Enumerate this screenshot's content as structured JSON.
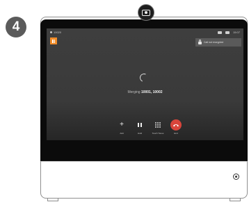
{
  "step": {
    "number": "4"
  },
  "status_bar": {
    "left_text": "10020",
    "right_text": "15:07"
  },
  "encryption": {
    "text": "Call not encrypted"
  },
  "call": {
    "merging_prefix": "Merging",
    "participants": "10001, 10002"
  },
  "controls": [
    {
      "label": "Add",
      "icon": "plus-icon"
    },
    {
      "label": "Hold",
      "icon": "pause-icon"
    },
    {
      "label": "Touch Tones",
      "icon": "keypad-icon"
    },
    {
      "label": "End",
      "icon": "hang-up-icon"
    }
  ],
  "colors": {
    "hold_indicator": "#f28c28",
    "end_button": "#d8453b"
  }
}
